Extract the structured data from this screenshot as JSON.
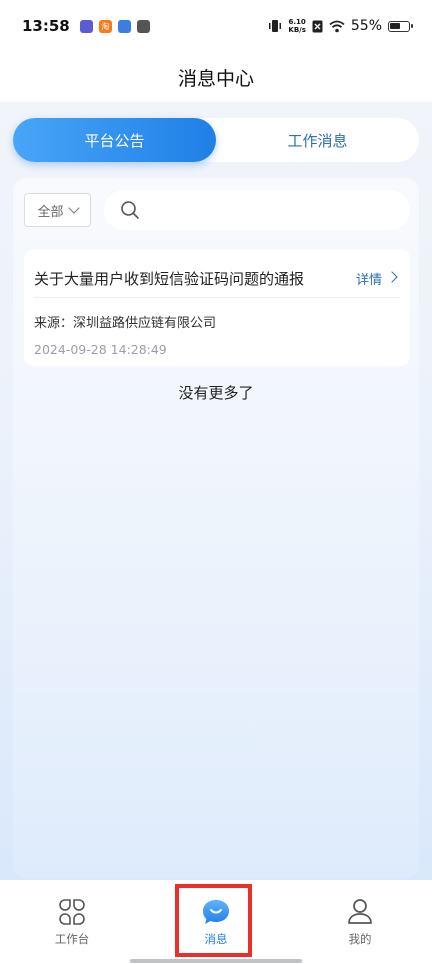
{
  "status_bar": {
    "time": "13:58",
    "apps": [
      {
        "icon": "app-icon-purple",
        "color": "#5b5bd6",
        "label": ""
      },
      {
        "icon": "taobao-icon",
        "color": "#f77a1b",
        "label": "淘"
      },
      {
        "icon": "app-icon-blue",
        "color": "#3b7de0",
        "label": ""
      },
      {
        "icon": "app-icon-gray",
        "color": "#555555",
        "label": ""
      }
    ],
    "speed_value": "6.10",
    "speed_unit": "KB/s",
    "battery": "55%"
  },
  "header": {
    "title": "消息中心"
  },
  "tabs": [
    {
      "label": "平台公告",
      "active": true
    },
    {
      "label": "工作消息",
      "active": false
    }
  ],
  "filter": {
    "selected": "全部"
  },
  "search": {
    "placeholder": "",
    "value": ""
  },
  "messages": [
    {
      "title": "关于大量用户收到短信验证码问题的通报",
      "detail_label": "详情",
      "source": "来源：深圳益路供应链有限公司",
      "time": "2024-09-28 14:28:49"
    }
  ],
  "footer_text": "没有更多了",
  "bottom_nav": [
    {
      "label": "工作台",
      "icon": "workbench-icon",
      "active": false
    },
    {
      "label": "消息",
      "icon": "message-icon",
      "active": true
    },
    {
      "label": "我的",
      "icon": "profile-icon",
      "active": false
    }
  ],
  "colors": {
    "accent": "#1f7fe6",
    "highlight": "#e8302a"
  }
}
